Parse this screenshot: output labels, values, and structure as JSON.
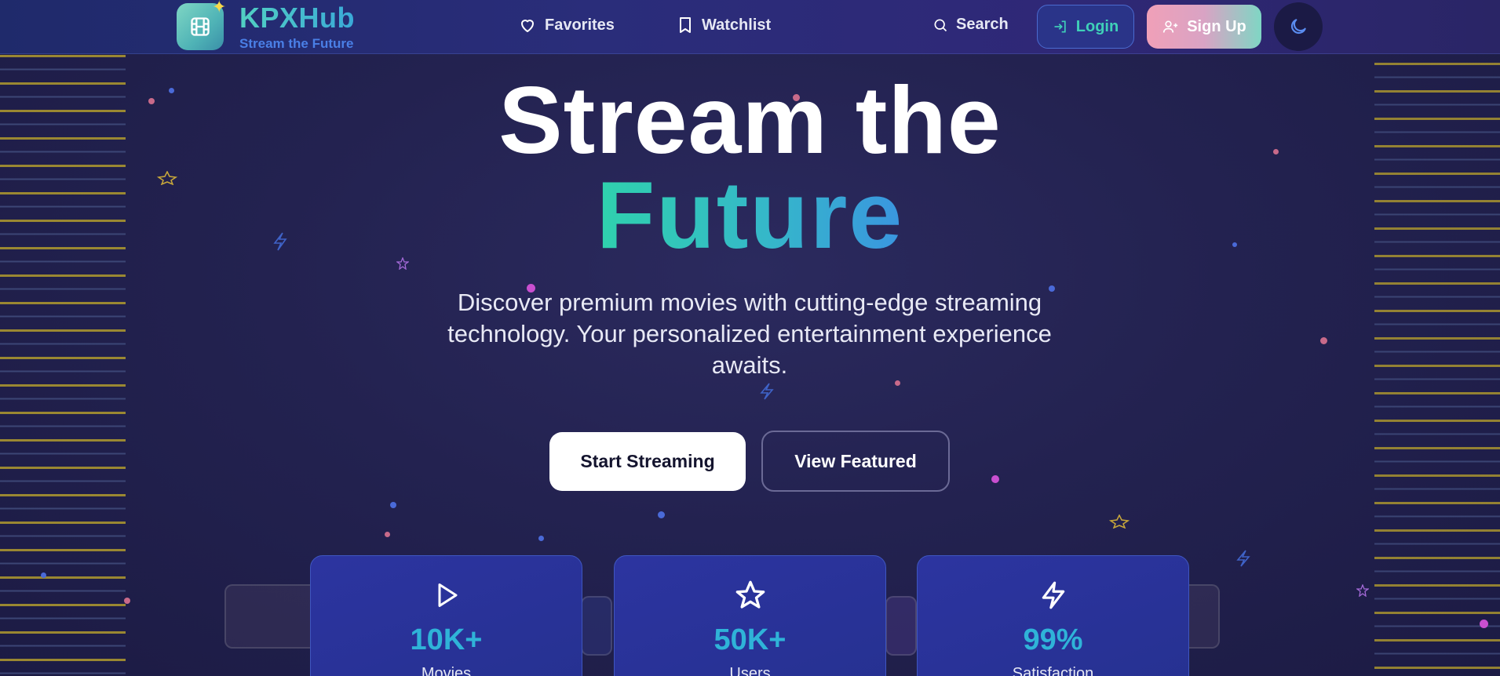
{
  "brand": {
    "title": "KPXHub",
    "tagline": "Stream the Future",
    "logo_icon": "film-icon"
  },
  "nav": {
    "favorites": "Favorites",
    "watchlist": "Watchlist",
    "search": "Search",
    "login": "Login",
    "signup": "Sign Up",
    "theme_icon": "moon-icon"
  },
  "hero": {
    "line1": "Stream the",
    "line2": "Future",
    "description": "Discover premium movies with cutting-edge streaming technology. Your personalized entertainment experience awaits.",
    "primary_cta": "Start Streaming",
    "secondary_cta": "View Featured"
  },
  "stats": [
    {
      "icon": "play-icon",
      "value": "10K+",
      "label": "Movies"
    },
    {
      "icon": "star-icon",
      "value": "50K+",
      "label": "Users"
    },
    {
      "icon": "zap-icon",
      "value": "99%",
      "label": "Satisfaction"
    }
  ],
  "colors": {
    "accent_teal": "#2fd1ad",
    "accent_blue": "#3a95e0",
    "background": "#232250",
    "stat_value": "#2fb3d8"
  }
}
